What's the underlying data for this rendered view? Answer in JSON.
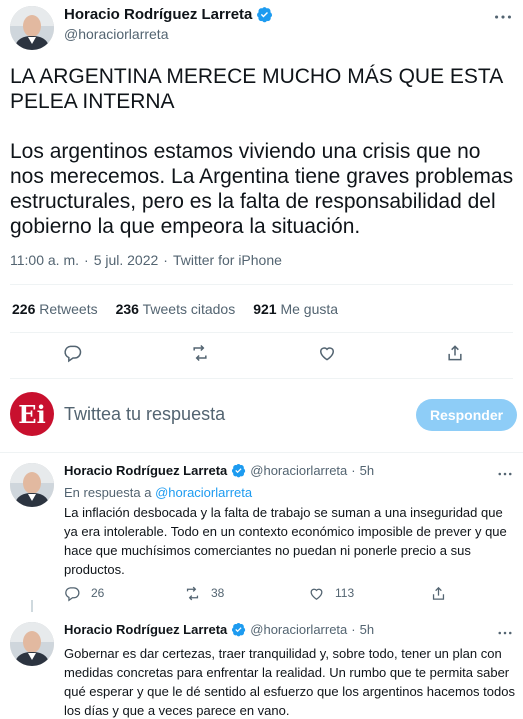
{
  "main_tweet": {
    "author_name": "Horacio Rodríguez Larreta",
    "handle": "@horaciorlarreta",
    "headline": "LA ARGENTINA MERECE MUCHO MÁS QUE ESTA PELEA INTERNA",
    "body": "Los argentinos estamos viviendo una crisis que no nos merecemos. La Argentina tiene graves problemas estructurales, pero es la falta de responsabilidad del gobierno la que empeora la situación.",
    "time": "11:00 a. m.",
    "date": "5 jul. 2022",
    "source": "Twitter for iPhone",
    "dot": "·",
    "stats": {
      "retweets_count": "226",
      "retweets_label": "Retweets",
      "quotes_count": "236",
      "quotes_label": "Tweets citados",
      "likes_count": "921",
      "likes_label": "Me gusta"
    }
  },
  "reply_composer": {
    "placeholder": "Twittea tu respuesta",
    "button_label": "Responder",
    "logo_text": "Ei"
  },
  "replies": [
    {
      "author_name": "Horacio Rodríguez Larreta",
      "handle": "@horaciorlarreta",
      "time": "5h",
      "dot": "·",
      "in_reply_prefix": "En respuesta a",
      "in_reply_handle": "@horaciorlarreta",
      "text": "La inflación desbocada y la falta de trabajo se suman a una inseguridad que ya era intolerable. Todo en un contexto económico imposible de prever y que hace que muchísimos comerciantes no puedan ni ponerle precio a sus productos.",
      "replies_count": "26",
      "retweets_count": "38",
      "likes_count": "113"
    },
    {
      "author_name": "Horacio Rodríguez Larreta",
      "handle": "@horaciorlarreta",
      "time": "5h",
      "dot": "·",
      "text": "Gobernar es dar certezas, traer tranquilidad y, sobre todo, tener un plan con medidas concretas para enfrentar la realidad. Un rumbo que te permita saber qué esperar y que le dé sentido al esfuerzo que los argentinos hacemos todos los días y que a veces parece en vano."
    }
  ],
  "colors": {
    "accent": "#1d9bf0",
    "muted": "#536471",
    "text": "#0f1419",
    "reply_button": "#8ecdf7",
    "logo_red": "#c8102e"
  },
  "icons": [
    "verified-badge-icon",
    "more-icon",
    "reply-icon",
    "retweet-icon",
    "like-icon",
    "share-icon"
  ]
}
